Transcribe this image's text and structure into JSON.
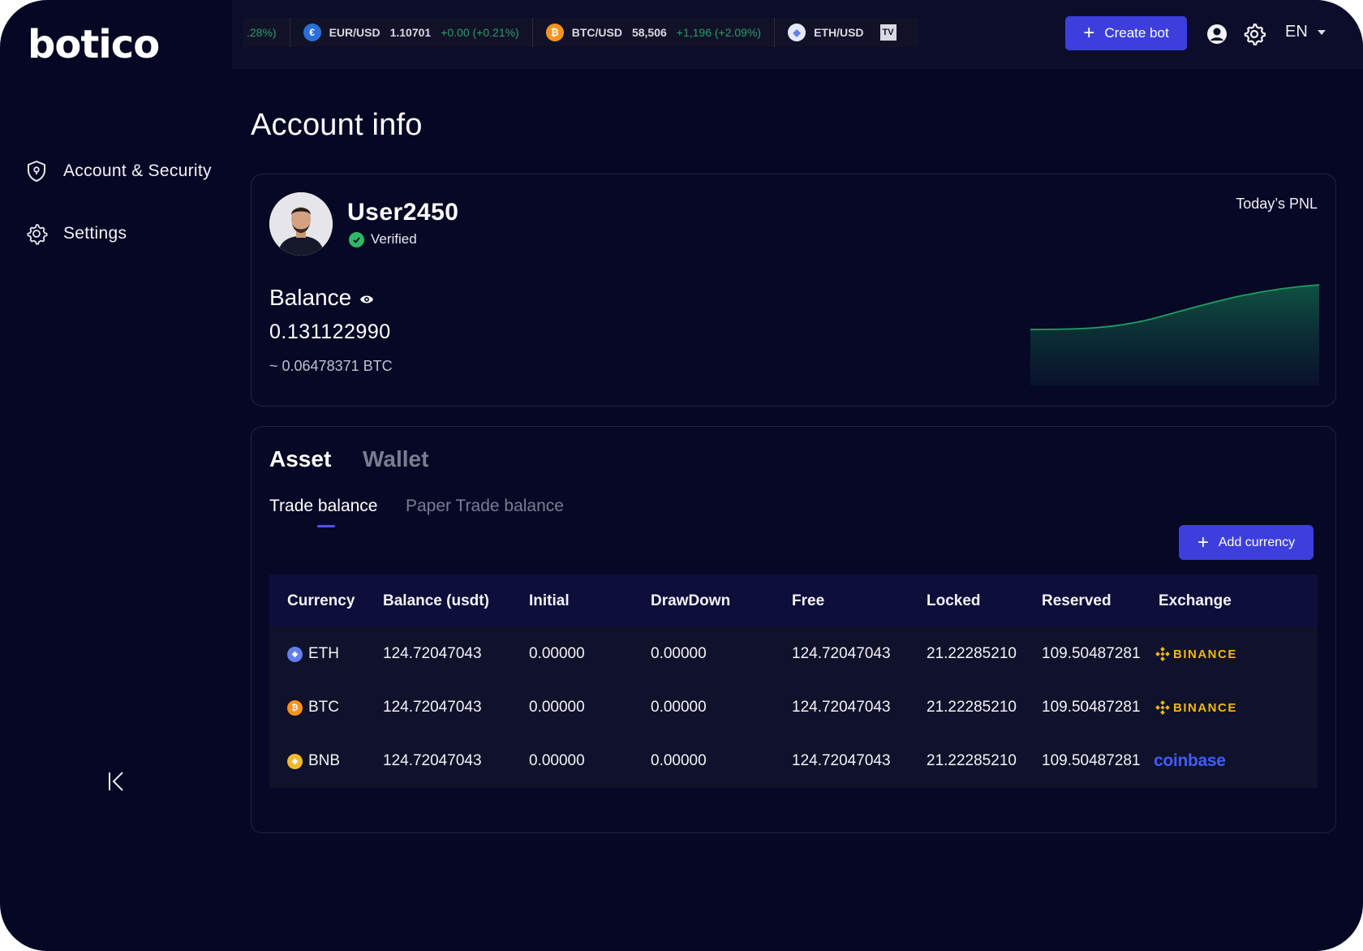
{
  "app": {
    "logo_text": "botico"
  },
  "sidebar": {
    "items": [
      {
        "label": "Account & Security",
        "icon": "shield-icon"
      },
      {
        "label": "Settings",
        "icon": "gear-icon"
      }
    ]
  },
  "ticker": [
    {
      "symbol": "",
      "price": "",
      "change": ".28%)"
    },
    {
      "symbol": "EUR/USD",
      "price": "1.10701",
      "change": "+0.00 (+0.21%)",
      "icon": "eur-usd-icon"
    },
    {
      "symbol": "BTC/USD",
      "price": "58,506",
      "change": "+1,196 (+2.09%)",
      "icon": "btc-icon"
    },
    {
      "symbol": "ETH/USD",
      "price": "",
      "change": "",
      "icon": "eth-icon"
    }
  ],
  "header": {
    "create_bot_label": "Create bot",
    "language": "EN"
  },
  "page": {
    "title": "Account info"
  },
  "account": {
    "username": "User2450",
    "verified_label": "Verified",
    "balance_label": "Balance",
    "balance_value": "0.131122990",
    "balance_btc": "~ 0.06478371 BTC",
    "pnl_label": "Today’s PNL",
    "colors": {
      "pnl_line": "#1f9e63",
      "verified": "#2fb866"
    }
  },
  "assets": {
    "tabs": [
      "Asset",
      "Wallet"
    ],
    "subtabs": [
      "Trade balance",
      "Paper Trade balance"
    ],
    "add_currency_label": "Add currency",
    "columns": [
      "Currency",
      "Balance (usdt)",
      "Initial",
      "DrawDown",
      "Free",
      "Locked",
      "Reserved",
      "Exchange"
    ],
    "rows": [
      {
        "currency": "ETH",
        "balance": "124.72047043",
        "initial": "0.00000",
        "drawdown": "0.00000",
        "free": "124.72047043",
        "locked": "21.22285210",
        "reserved": "109.50487281",
        "exchange": "BINANCE"
      },
      {
        "currency": "BTC",
        "balance": "124.72047043",
        "initial": "0.00000",
        "drawdown": "0.00000",
        "free": "124.72047043",
        "locked": "21.22285210",
        "reserved": "109.50487281",
        "exchange": "BINANCE"
      },
      {
        "currency": "BNB",
        "balance": "124.72047043",
        "initial": "0.00000",
        "drawdown": "0.00000",
        "free": "124.72047043",
        "locked": "21.22285210",
        "reserved": "109.50487281",
        "exchange": "coinbase"
      }
    ],
    "colors": {
      "accent": "#3d3fdc",
      "binance": "#f0b90b",
      "coinbase": "#3e5dff"
    }
  }
}
